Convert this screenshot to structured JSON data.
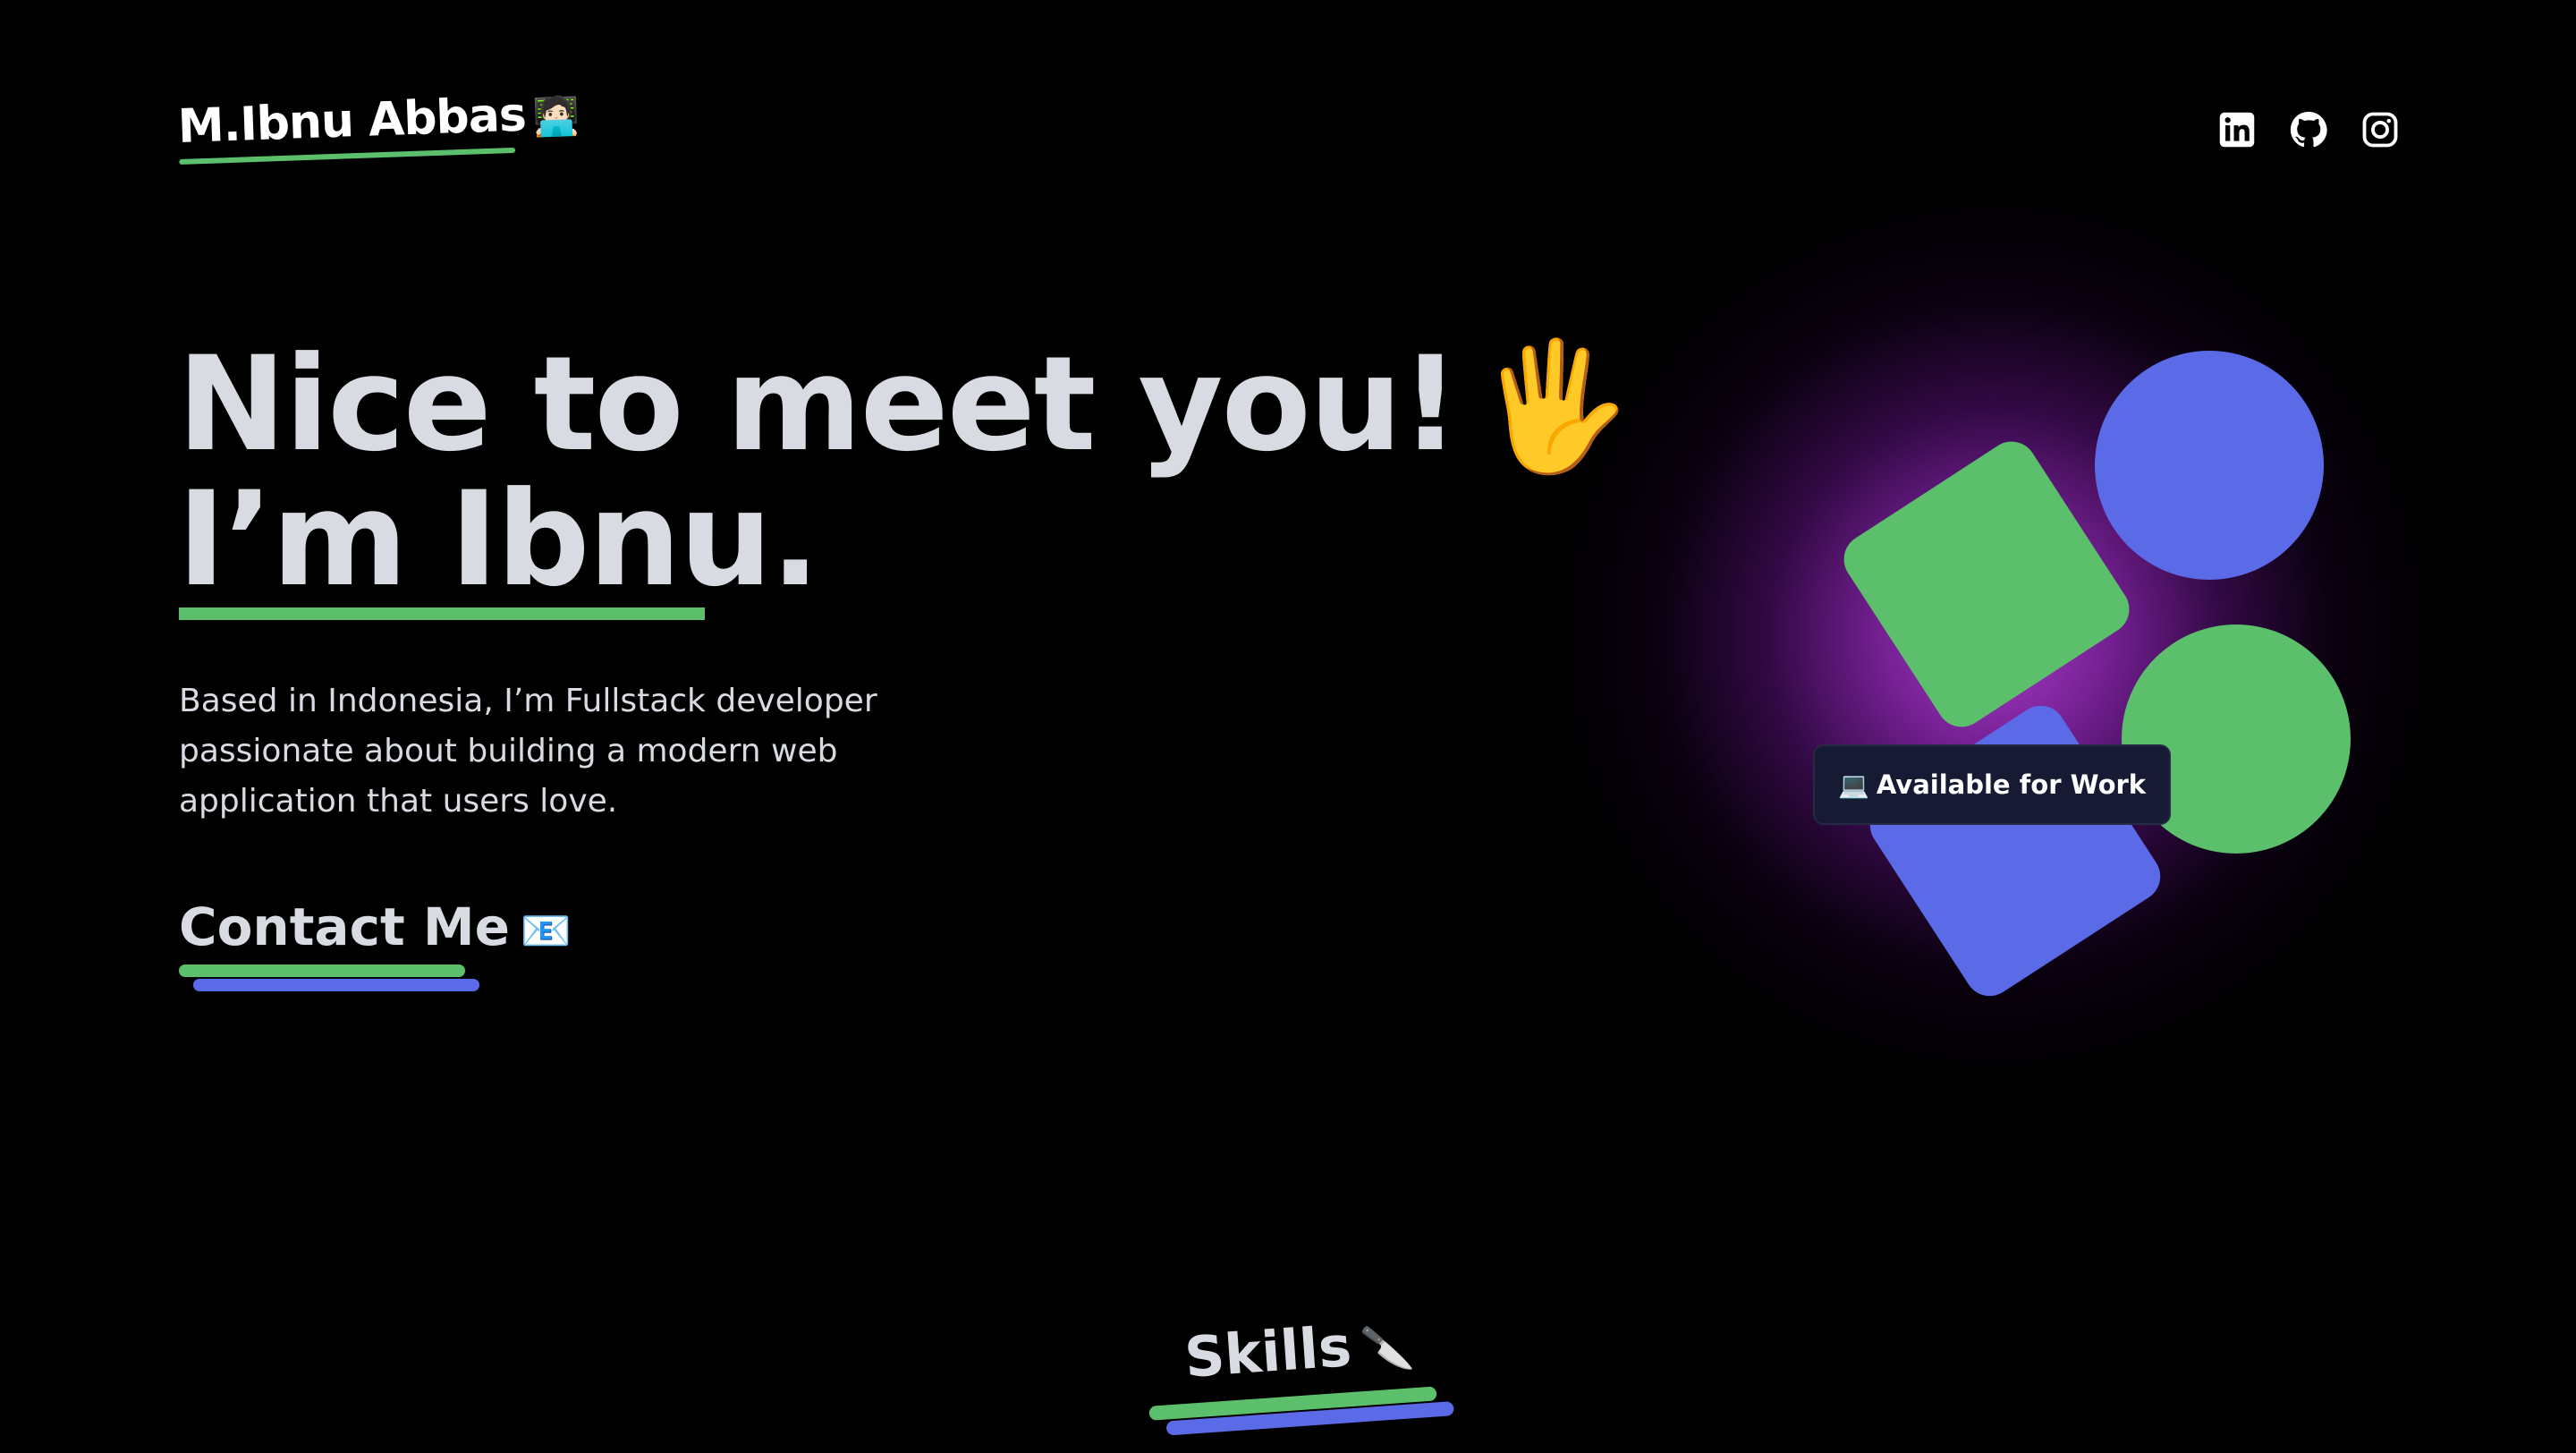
{
  "header": {
    "logo_name": "M.Ibnu Abbas",
    "logo_emoji": "🧑🏻‍💻",
    "social": [
      {
        "name": "linkedin-icon"
      },
      {
        "name": "github-icon"
      },
      {
        "name": "instagram-icon"
      }
    ]
  },
  "hero": {
    "line1": "Nice to meet you!",
    "wave_emoji": "🖐️",
    "line2": "I’m Ibnu.",
    "intro": "Based in Indonesia, I’m Fullstack developer passionate about building a modern web application that users love.",
    "contact_label": "Contact Me",
    "contact_emoji": "📧"
  },
  "illustration": {
    "badge_emoji": "💻",
    "badge_text": "Available for Work"
  },
  "skills": {
    "label": "Skills",
    "emoji": "🔪"
  },
  "colors": {
    "background": "#000000",
    "text": "#d9dbe2",
    "green": "#5cbf6b",
    "blue": "#5b6ae6",
    "glow": "#b540d6",
    "badge_bg": "#171a33"
  }
}
